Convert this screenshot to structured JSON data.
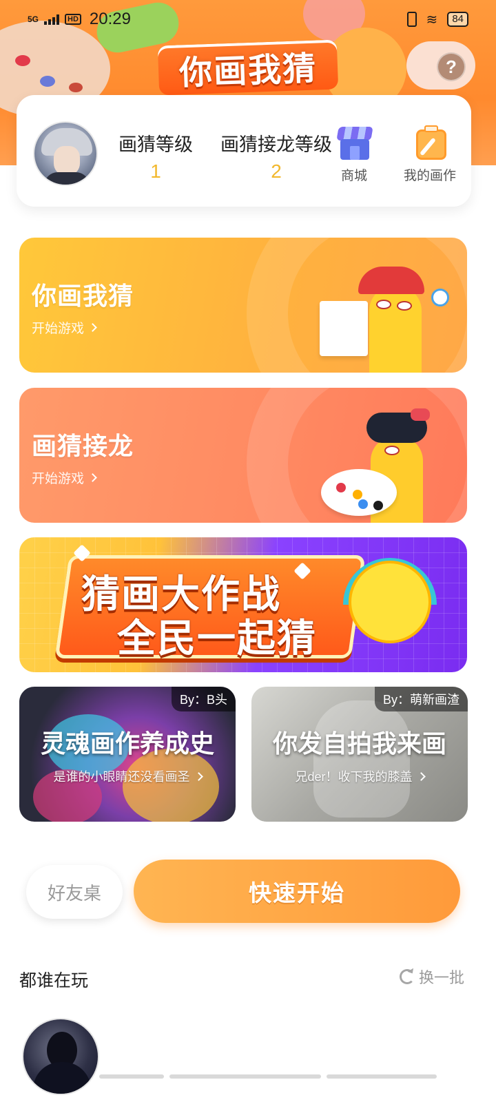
{
  "status_bar": {
    "network": "5G",
    "hd": "HD",
    "time": "20:29",
    "battery": "84"
  },
  "header": {
    "game_title": "你画我猜",
    "help_label": "?"
  },
  "profile": {
    "levels": [
      {
        "label": "画猜等级",
        "value": "1"
      },
      {
        "label": "画猜接龙等级",
        "value": "2"
      }
    ],
    "shortcuts": [
      {
        "label": "商城",
        "icon": "shop-icon"
      },
      {
        "label": "我的画作",
        "icon": "my-drawings-icon"
      }
    ]
  },
  "modes": [
    {
      "title": "你画我猜",
      "action": "开始游戏"
    },
    {
      "title": "画猜接龙",
      "action": "开始游戏"
    }
  ],
  "promo_banner": {
    "line1": "猜画大作战",
    "line2": "全民一起猜"
  },
  "art_cards": [
    {
      "by": "By：B头",
      "title": "灵魂画作养成史",
      "subtitle": "是谁的小眼睛还没看画圣"
    },
    {
      "by": "By：萌新画渣",
      "title": "你发自拍我来画",
      "subtitle": "兄der！收下我的膝盖"
    }
  ],
  "actions": {
    "friend_table": "好友桌",
    "quick_start": "快速开始"
  },
  "players_section": {
    "title": "都谁在玩",
    "refresh": "换一批"
  },
  "colors": {
    "accent_orange": "#ff9a3a",
    "level_gold": "#f2b82d",
    "card_yellow": "#ffc83a",
    "card_coral": "#ff8a62"
  }
}
